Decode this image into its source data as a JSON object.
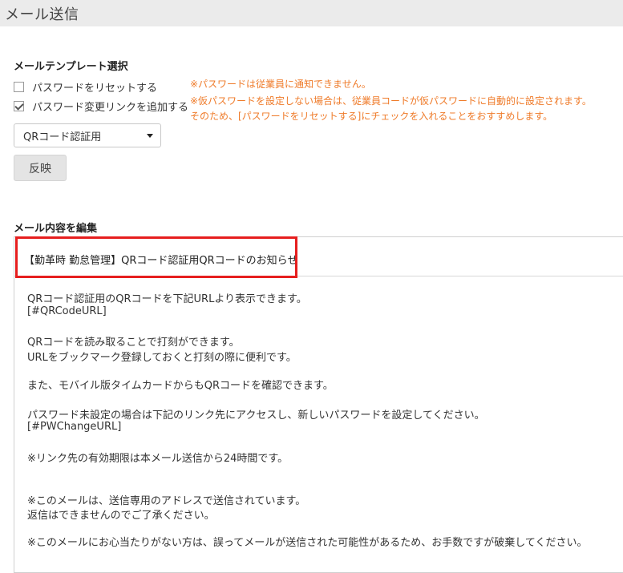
{
  "window": {
    "title": "メール送信"
  },
  "template_section": {
    "title": "メールテンプレート選択",
    "checkbox_reset": {
      "label": "パスワードをリセットする",
      "checked": false
    },
    "checkbox_link": {
      "label": "パスワード変更リンクを追加する",
      "checked": true
    },
    "template_select": {
      "value": "QRコード認証用"
    },
    "apply_button": "反映"
  },
  "notes": [
    "※パスワードは従業員に通知できません。",
    "※仮パスワードを設定しない場合は、従業員コードが仮パスワードに自動的に設定されます。",
    "そのため、[パスワードをリセットする]にチェックを入れることをおすすめします。"
  ],
  "edit_section": {
    "title": "メール内容を編集",
    "subject": "【勤革時 勤怠管理】QRコード認証用QRコードのお知らせ",
    "body_lines": [
      "QRコード認証用のQRコードを下記URLより表示できます。",
      "[#QRCodeURL]",
      "QRコードを読み取ることで打刻ができます。",
      "URLをブックマーク登録しておくと打刻の際に便利です。",
      "また、モバイル版タイムカードからもQRコードを確認できます。",
      "パスワード未設定の場合は下記のリンク先にアクセスし、新しいパスワードを設定してください。",
      "[#PWChangeURL]",
      "※リンク先の有効期限は本メール送信から24時間です。",
      "※このメールは、送信専用のアドレスで送信されています。",
      "返信はできませんのでご了承ください。",
      "※このメールにお心当たりがない方は、誤ってメールが送信された可能性があるため、お手数ですが破棄してください。"
    ]
  },
  "colors": {
    "note": "#ef7b2a",
    "highlight": "#e61e1e",
    "titlebar_bg": "#ebebeb"
  }
}
